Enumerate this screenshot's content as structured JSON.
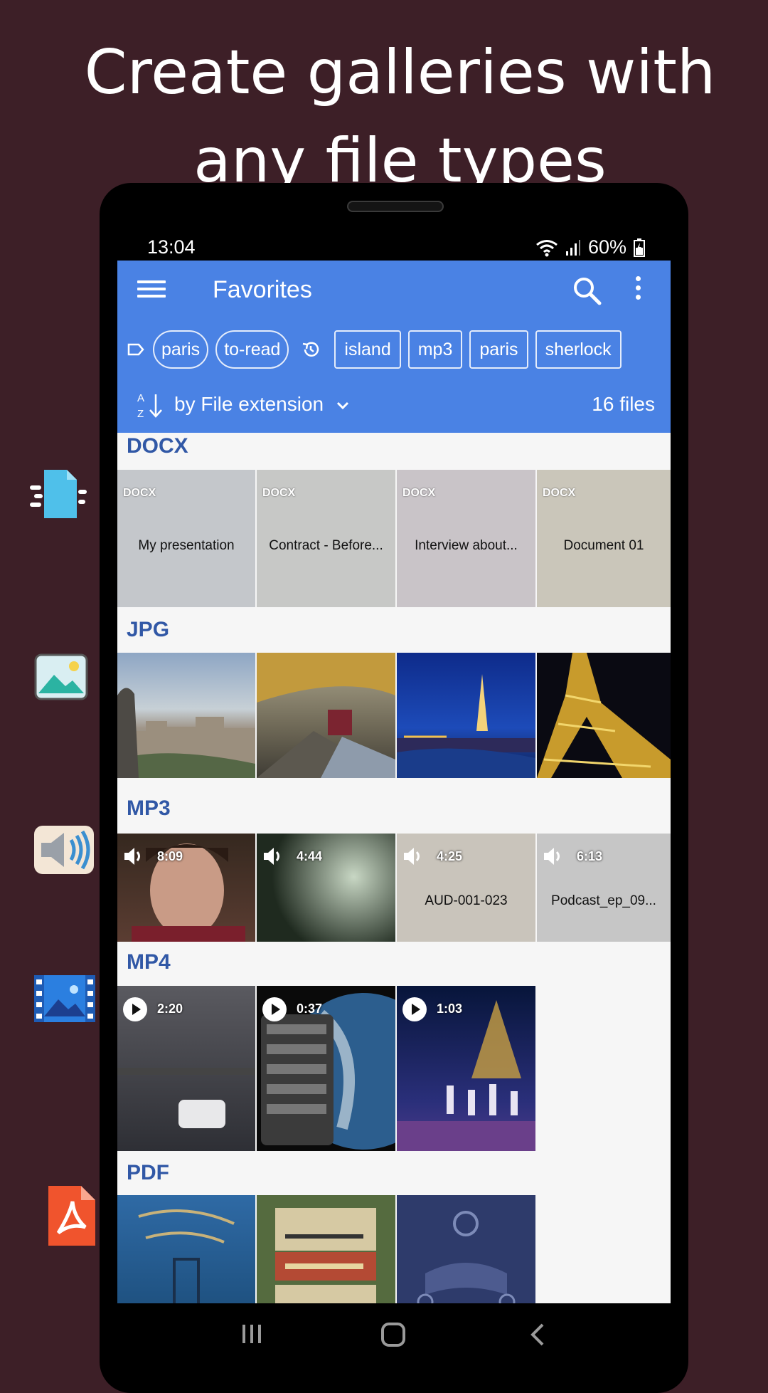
{
  "headline": {
    "line1": "Create galleries with",
    "line2_underlined": "any",
    "line2_rest": " file types"
  },
  "status": {
    "time": "13:04",
    "battery": "60%"
  },
  "appbar": {
    "title": "Favorites"
  },
  "tags": [
    {
      "label": "paris"
    },
    {
      "label": "to-read"
    }
  ],
  "recent": [
    {
      "label": "island"
    },
    {
      "label": "mp3"
    },
    {
      "label": "paris"
    },
    {
      "label": "sherlock"
    }
  ],
  "sort": {
    "label": "by File extension",
    "count": "16 files"
  },
  "sections": {
    "docx": {
      "title": "DOCX",
      "items": [
        {
          "ext": "DOCX",
          "name": "My presentation",
          "color": "#c4c7cb"
        },
        {
          "ext": "DOCX",
          "name": "Contract - Before...",
          "color": "#c7c8c6"
        },
        {
          "ext": "DOCX",
          "name": "Interview about...",
          "color": "#c9c4c8"
        },
        {
          "ext": "DOCX",
          "name": "Document 01",
          "color": "#cac6ba"
        }
      ]
    },
    "jpg": {
      "title": "JPG"
    },
    "mp3": {
      "title": "MP3",
      "items": [
        {
          "duration": "8:09",
          "name": ""
        },
        {
          "duration": "4:44",
          "name": ""
        },
        {
          "duration": "4:25",
          "name": "AUD-001-023"
        },
        {
          "duration": "6:13",
          "name": "Podcast_ep_09..."
        }
      ]
    },
    "mp4": {
      "title": "MP4",
      "items": [
        {
          "duration": "2:20"
        },
        {
          "duration": "0:37"
        },
        {
          "duration": "1:03"
        }
      ]
    },
    "pdf": {
      "title": "PDF"
    }
  },
  "colors": {
    "page_bg": "#3d1f27",
    "appbar": "#4a82e4",
    "section_title": "#3158a6"
  }
}
